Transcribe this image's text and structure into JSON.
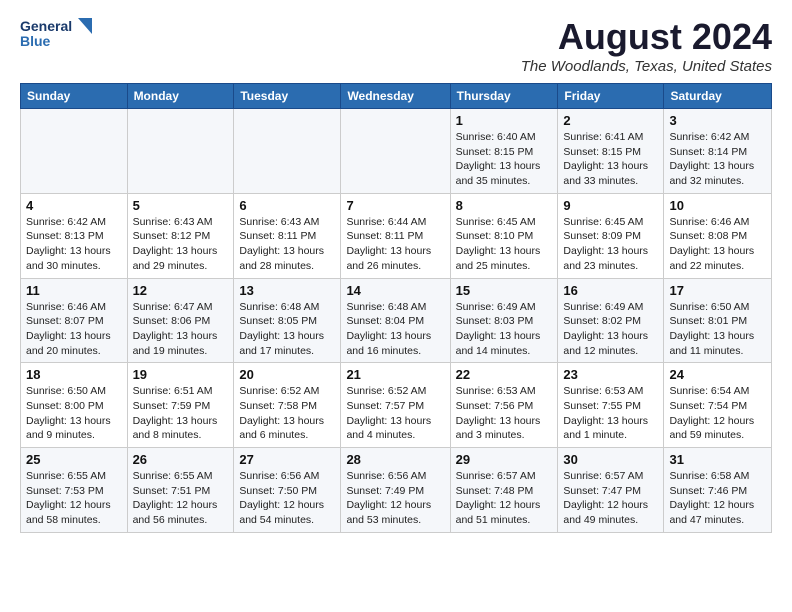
{
  "logo": {
    "line1": "General",
    "line2": "Blue"
  },
  "title": "August 2024",
  "subtitle": "The Woodlands, Texas, United States",
  "weekdays": [
    "Sunday",
    "Monday",
    "Tuesday",
    "Wednesday",
    "Thursday",
    "Friday",
    "Saturday"
  ],
  "weeks": [
    [
      {
        "day": "",
        "sunrise": "",
        "sunset": "",
        "daylight": ""
      },
      {
        "day": "",
        "sunrise": "",
        "sunset": "",
        "daylight": ""
      },
      {
        "day": "",
        "sunrise": "",
        "sunset": "",
        "daylight": ""
      },
      {
        "day": "",
        "sunrise": "",
        "sunset": "",
        "daylight": ""
      },
      {
        "day": "1",
        "sunrise": "Sunrise: 6:40 AM",
        "sunset": "Sunset: 8:15 PM",
        "daylight": "Daylight: 13 hours and 35 minutes."
      },
      {
        "day": "2",
        "sunrise": "Sunrise: 6:41 AM",
        "sunset": "Sunset: 8:15 PM",
        "daylight": "Daylight: 13 hours and 33 minutes."
      },
      {
        "day": "3",
        "sunrise": "Sunrise: 6:42 AM",
        "sunset": "Sunset: 8:14 PM",
        "daylight": "Daylight: 13 hours and 32 minutes."
      }
    ],
    [
      {
        "day": "4",
        "sunrise": "Sunrise: 6:42 AM",
        "sunset": "Sunset: 8:13 PM",
        "daylight": "Daylight: 13 hours and 30 minutes."
      },
      {
        "day": "5",
        "sunrise": "Sunrise: 6:43 AM",
        "sunset": "Sunset: 8:12 PM",
        "daylight": "Daylight: 13 hours and 29 minutes."
      },
      {
        "day": "6",
        "sunrise": "Sunrise: 6:43 AM",
        "sunset": "Sunset: 8:11 PM",
        "daylight": "Daylight: 13 hours and 28 minutes."
      },
      {
        "day": "7",
        "sunrise": "Sunrise: 6:44 AM",
        "sunset": "Sunset: 8:11 PM",
        "daylight": "Daylight: 13 hours and 26 minutes."
      },
      {
        "day": "8",
        "sunrise": "Sunrise: 6:45 AM",
        "sunset": "Sunset: 8:10 PM",
        "daylight": "Daylight: 13 hours and 25 minutes."
      },
      {
        "day": "9",
        "sunrise": "Sunrise: 6:45 AM",
        "sunset": "Sunset: 8:09 PM",
        "daylight": "Daylight: 13 hours and 23 minutes."
      },
      {
        "day": "10",
        "sunrise": "Sunrise: 6:46 AM",
        "sunset": "Sunset: 8:08 PM",
        "daylight": "Daylight: 13 hours and 22 minutes."
      }
    ],
    [
      {
        "day": "11",
        "sunrise": "Sunrise: 6:46 AM",
        "sunset": "Sunset: 8:07 PM",
        "daylight": "Daylight: 13 hours and 20 minutes."
      },
      {
        "day": "12",
        "sunrise": "Sunrise: 6:47 AM",
        "sunset": "Sunset: 8:06 PM",
        "daylight": "Daylight: 13 hours and 19 minutes."
      },
      {
        "day": "13",
        "sunrise": "Sunrise: 6:48 AM",
        "sunset": "Sunset: 8:05 PM",
        "daylight": "Daylight: 13 hours and 17 minutes."
      },
      {
        "day": "14",
        "sunrise": "Sunrise: 6:48 AM",
        "sunset": "Sunset: 8:04 PM",
        "daylight": "Daylight: 13 hours and 16 minutes."
      },
      {
        "day": "15",
        "sunrise": "Sunrise: 6:49 AM",
        "sunset": "Sunset: 8:03 PM",
        "daylight": "Daylight: 13 hours and 14 minutes."
      },
      {
        "day": "16",
        "sunrise": "Sunrise: 6:49 AM",
        "sunset": "Sunset: 8:02 PM",
        "daylight": "Daylight: 13 hours and 12 minutes."
      },
      {
        "day": "17",
        "sunrise": "Sunrise: 6:50 AM",
        "sunset": "Sunset: 8:01 PM",
        "daylight": "Daylight: 13 hours and 11 minutes."
      }
    ],
    [
      {
        "day": "18",
        "sunrise": "Sunrise: 6:50 AM",
        "sunset": "Sunset: 8:00 PM",
        "daylight": "Daylight: 13 hours and 9 minutes."
      },
      {
        "day": "19",
        "sunrise": "Sunrise: 6:51 AM",
        "sunset": "Sunset: 7:59 PM",
        "daylight": "Daylight: 13 hours and 8 minutes."
      },
      {
        "day": "20",
        "sunrise": "Sunrise: 6:52 AM",
        "sunset": "Sunset: 7:58 PM",
        "daylight": "Daylight: 13 hours and 6 minutes."
      },
      {
        "day": "21",
        "sunrise": "Sunrise: 6:52 AM",
        "sunset": "Sunset: 7:57 PM",
        "daylight": "Daylight: 13 hours and 4 minutes."
      },
      {
        "day": "22",
        "sunrise": "Sunrise: 6:53 AM",
        "sunset": "Sunset: 7:56 PM",
        "daylight": "Daylight: 13 hours and 3 minutes."
      },
      {
        "day": "23",
        "sunrise": "Sunrise: 6:53 AM",
        "sunset": "Sunset: 7:55 PM",
        "daylight": "Daylight: 13 hours and 1 minute."
      },
      {
        "day": "24",
        "sunrise": "Sunrise: 6:54 AM",
        "sunset": "Sunset: 7:54 PM",
        "daylight": "Daylight: 12 hours and 59 minutes."
      }
    ],
    [
      {
        "day": "25",
        "sunrise": "Sunrise: 6:55 AM",
        "sunset": "Sunset: 7:53 PM",
        "daylight": "Daylight: 12 hours and 58 minutes."
      },
      {
        "day": "26",
        "sunrise": "Sunrise: 6:55 AM",
        "sunset": "Sunset: 7:51 PM",
        "daylight": "Daylight: 12 hours and 56 minutes."
      },
      {
        "day": "27",
        "sunrise": "Sunrise: 6:56 AM",
        "sunset": "Sunset: 7:50 PM",
        "daylight": "Daylight: 12 hours and 54 minutes."
      },
      {
        "day": "28",
        "sunrise": "Sunrise: 6:56 AM",
        "sunset": "Sunset: 7:49 PM",
        "daylight": "Daylight: 12 hours and 53 minutes."
      },
      {
        "day": "29",
        "sunrise": "Sunrise: 6:57 AM",
        "sunset": "Sunset: 7:48 PM",
        "daylight": "Daylight: 12 hours and 51 minutes."
      },
      {
        "day": "30",
        "sunrise": "Sunrise: 6:57 AM",
        "sunset": "Sunset: 7:47 PM",
        "daylight": "Daylight: 12 hours and 49 minutes."
      },
      {
        "day": "31",
        "sunrise": "Sunrise: 6:58 AM",
        "sunset": "Sunset: 7:46 PM",
        "daylight": "Daylight: 12 hours and 47 minutes."
      }
    ]
  ]
}
